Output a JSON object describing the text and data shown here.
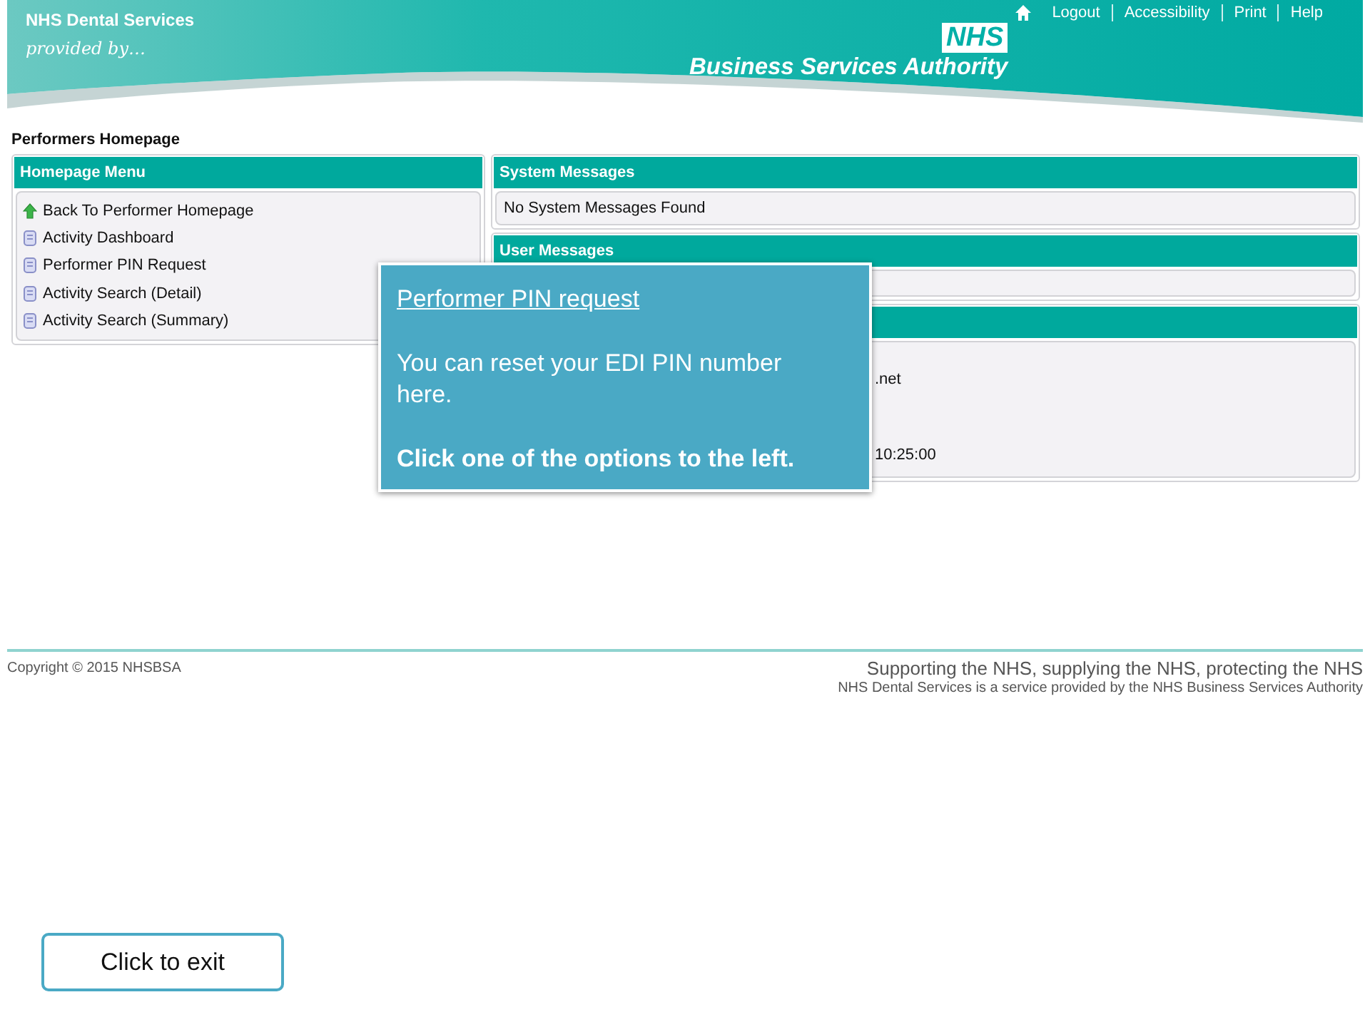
{
  "header": {
    "site_name": "NHS Dental Services",
    "tagline": "provided by…",
    "logo_mark": "NHS",
    "logo_text": "Business Services Authority",
    "links": [
      "Logout",
      "Accessibility",
      "Print",
      "Help"
    ]
  },
  "page_title": "Performers Homepage",
  "menu": {
    "title": "Homepage Menu",
    "items": [
      {
        "label": "Back To Performer Homepage",
        "kind": "back"
      },
      {
        "label": "Activity Dashboard",
        "kind": "page"
      },
      {
        "label": "Performer PIN Request",
        "kind": "page"
      },
      {
        "label": "Activity Search (Detail)",
        "kind": "page"
      },
      {
        "label": "Activity Search (Summary)",
        "kind": "page"
      }
    ]
  },
  "panels": [
    {
      "title": "System Messages",
      "lines": [
        "No System Messages Found"
      ]
    },
    {
      "title": "User Messages"
    },
    {
      "lines": [
        ".net",
        "10:25:00"
      ]
    }
  ],
  "tooltip": {
    "title": "Performer PIN request",
    "body": "You can reset your EDI PIN number here.",
    "instruction": "Click one of the options to the left."
  },
  "footer": {
    "copyright": "Copyright © 2015 NHSBSA",
    "slogan": "Supporting the NHS, supplying the NHS, protecting the NHS",
    "note": "NHS Dental Services is a service provided by the NHS Business Services Authority"
  },
  "exit_button": "Click to exit"
}
